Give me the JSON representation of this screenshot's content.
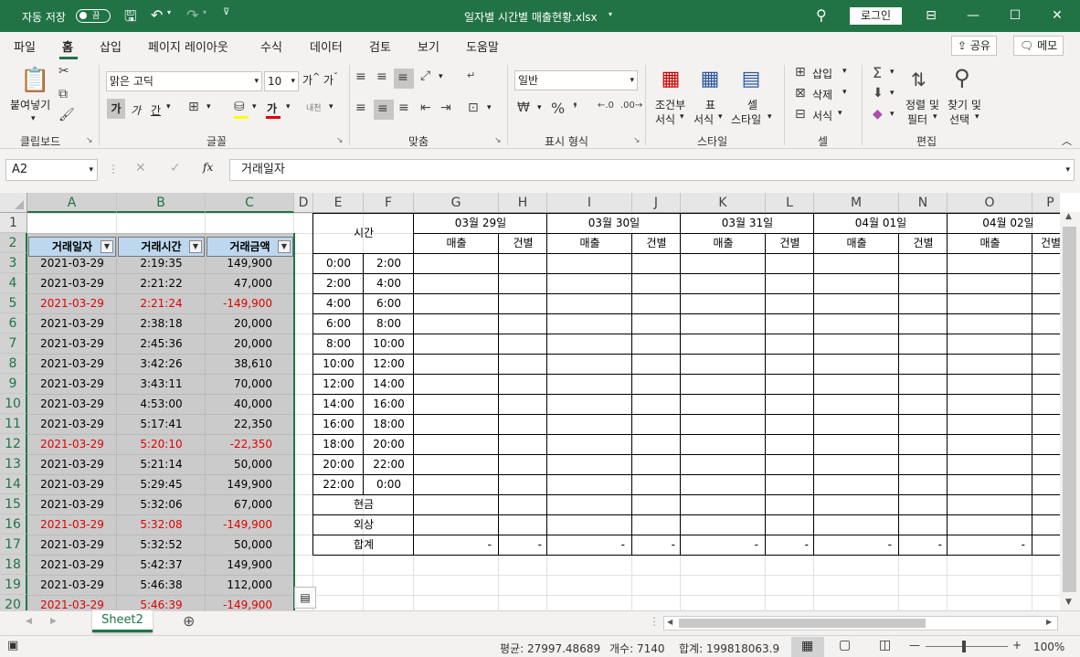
{
  "title_bar": {
    "autosave_label": "자동 저장",
    "autosave_state": "끔",
    "file_title": "일자별 시간별 매출현황.xlsx",
    "login_label": "로그인"
  },
  "tabs": [
    "파일",
    "홈",
    "삽입",
    "페이지 레이아웃",
    "수식",
    "데이터",
    "검토",
    "보기",
    "도움말"
  ],
  "share_label": "공유",
  "memo_label": "메모",
  "ribbon": {
    "paste_label": "붙여넣기",
    "clipboard_group": "클립보드",
    "font_name": "맑은 고딕",
    "font_size": "10",
    "font_group": "글꼴",
    "align_group": "맞춤",
    "number_format": "일반",
    "number_group": "표시 형식",
    "cond_format_label": [
      "조건부",
      "서식"
    ],
    "table_format_label": [
      "표",
      "서식"
    ],
    "cell_style_label": [
      "셀",
      "스타일"
    ],
    "style_group": "스타일",
    "insert_label": "삽입",
    "delete_label": "삭제",
    "format_label": "서식",
    "cells_group": "셀",
    "sort_label": [
      "정렬 및",
      "필터"
    ],
    "find_label": [
      "찾기 및",
      "선택"
    ],
    "edit_group": "편집",
    "bold": "가",
    "italic": "가",
    "underline": "간",
    "font_color_glyph": "가"
  },
  "formula_bar": {
    "name_box": "A2",
    "formula": "거래일자"
  },
  "columns": [
    "A",
    "B",
    "C",
    "D",
    "E",
    "F",
    "G",
    "H",
    "I",
    "J",
    "K",
    "L",
    "M",
    "N",
    "O",
    "P"
  ],
  "rows": [
    "1",
    "2",
    "3",
    "4",
    "5",
    "6",
    "7",
    "8",
    "9",
    "10",
    "11",
    "12",
    "13",
    "14",
    "15",
    "16",
    "17",
    "18",
    "19",
    "20"
  ],
  "table_headers": [
    "거래일자",
    "거래시간",
    "거래금액"
  ],
  "transactions": [
    {
      "date": "2021-03-29",
      "time": "2:19:35",
      "amount": "149,900",
      "negative": false
    },
    {
      "date": "2021-03-29",
      "time": "2:21:22",
      "amount": "47,000",
      "negative": false
    },
    {
      "date": "2021-03-29",
      "time": "2:21:24",
      "amount": "-149,900",
      "negative": true
    },
    {
      "date": "2021-03-29",
      "time": "2:38:18",
      "amount": "20,000",
      "negative": false
    },
    {
      "date": "2021-03-29",
      "time": "2:45:36",
      "amount": "20,000",
      "negative": false
    },
    {
      "date": "2021-03-29",
      "time": "3:42:26",
      "amount": "38,610",
      "negative": false
    },
    {
      "date": "2021-03-29",
      "time": "3:43:11",
      "amount": "70,000",
      "negative": false
    },
    {
      "date": "2021-03-29",
      "time": "4:53:00",
      "amount": "40,000",
      "negative": false
    },
    {
      "date": "2021-03-29",
      "time": "5:17:41",
      "amount": "22,350",
      "negative": false
    },
    {
      "date": "2021-03-29",
      "time": "5:20:10",
      "amount": "-22,350",
      "negative": true
    },
    {
      "date": "2021-03-29",
      "time": "5:21:14",
      "amount": "50,000",
      "negative": false
    },
    {
      "date": "2021-03-29",
      "time": "5:29:45",
      "amount": "149,900",
      "negative": false
    },
    {
      "date": "2021-03-29",
      "time": "5:32:06",
      "amount": "67,000",
      "negative": false
    },
    {
      "date": "2021-03-29",
      "time": "5:32:08",
      "amount": "-149,900",
      "negative": true
    },
    {
      "date": "2021-03-29",
      "time": "5:32:52",
      "amount": "50,000",
      "negative": false
    },
    {
      "date": "2021-03-29",
      "time": "5:42:37",
      "amount": "149,900",
      "negative": false
    },
    {
      "date": "2021-03-29",
      "time": "5:46:38",
      "amount": "112,000",
      "negative": false
    },
    {
      "date": "2021-03-29",
      "time": "5:46:39",
      "amount": "-149,900",
      "negative": true
    }
  ],
  "summary": {
    "time_header": "시간",
    "dates": [
      "03월 29일",
      "03월 30일",
      "03월 31일",
      "04월 01일",
      "04월 02일"
    ],
    "sales_label": "매출",
    "count_label": "건별",
    "slots": [
      [
        "0:00",
        "2:00"
      ],
      [
        "2:00",
        "4:00"
      ],
      [
        "4:00",
        "6:00"
      ],
      [
        "6:00",
        "8:00"
      ],
      [
        "8:00",
        "10:00"
      ],
      [
        "10:00",
        "12:00"
      ],
      [
        "12:00",
        "14:00"
      ],
      [
        "14:00",
        "16:00"
      ],
      [
        "16:00",
        "18:00"
      ],
      [
        "18:00",
        "20:00"
      ],
      [
        "20:00",
        "22:00"
      ],
      [
        "22:00",
        "0:00"
      ]
    ],
    "cash_label": "현금",
    "credit_label": "외상",
    "total_label": "합계",
    "dash": "-"
  },
  "sheet_tab": "Sheet2",
  "status": {
    "average": "평균: 27997.48689",
    "count": "개수: 7140",
    "sum": "합계: 199818063.9",
    "zoom": "100%"
  },
  "colors": {
    "accent": "#217346",
    "table_header": "#bdd7ee",
    "negative": "#e00000"
  }
}
